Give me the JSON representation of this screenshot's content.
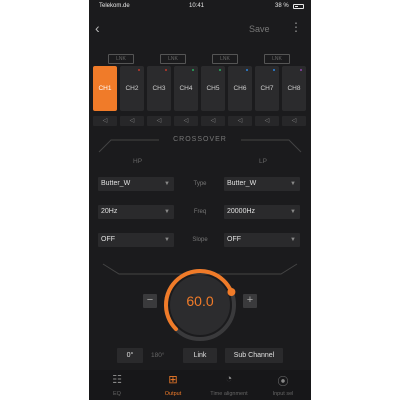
{
  "status": {
    "carrier": "Telekom.de",
    "time": "10:41",
    "battery": "38 %"
  },
  "nav": {
    "back_icon": "chevron-left-icon",
    "save_label": "Save",
    "more_icon": "more-vertical-icon"
  },
  "link_buttons": [
    "LNK",
    "LNK",
    "LNK",
    "LNK"
  ],
  "channels": [
    {
      "label": "CH1",
      "dot": ""
    },
    {
      "label": "CH2",
      "dot": "#c0392b"
    },
    {
      "label": "CH3",
      "dot": "#c0392b"
    },
    {
      "label": "CH4",
      "dot": "#27ae60"
    },
    {
      "label": "CH5",
      "dot": "#27ae60"
    },
    {
      "label": "CH6",
      "dot": "#2e86de"
    },
    {
      "label": "CH7",
      "dot": "#2e86de"
    },
    {
      "label": "CH8",
      "dot": "#8e44ad"
    }
  ],
  "active_channel": 0,
  "crossover": {
    "title": "CROSSOVER",
    "hp_label": "HP",
    "lp_label": "LP",
    "type_label": "Type",
    "freq_label": "Freq",
    "slope_label": "Slope",
    "hp_type": "Butter_W",
    "lp_type": "Butter_W",
    "hp_freq": "20Hz",
    "lp_freq": "20000Hz",
    "hp_slope": "OFF",
    "lp_slope": "OFF"
  },
  "knob": {
    "value": "60.0",
    "level": 0.75,
    "minus": "−",
    "plus": "+"
  },
  "bottom": {
    "phase_0": "0°",
    "phase_180": "180°",
    "link_label": "Link",
    "sub_channel_label": "Sub Channel"
  },
  "tabs": [
    {
      "label": "EQ",
      "icon": "equalizer-icon"
    },
    {
      "label": "Output",
      "icon": "output-icon"
    },
    {
      "label": "Time alignment",
      "icon": "clock-icon"
    },
    {
      "label": "Input sel",
      "icon": "input-icon"
    }
  ],
  "active_tab": 1,
  "colors": {
    "accent": "#f07b29",
    "background": "#1b1b1d",
    "control": "#2a2a2c"
  }
}
